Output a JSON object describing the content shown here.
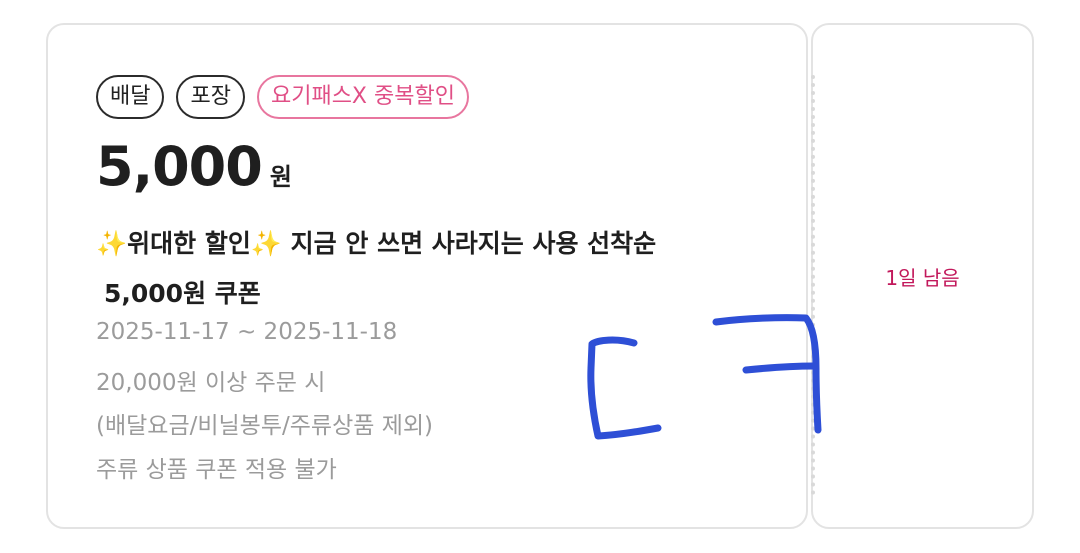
{
  "coupon": {
    "tags": [
      "배달",
      "포장",
      "요기패스X 중복할인"
    ],
    "price": {
      "value": "5,000",
      "unit": "원"
    },
    "title": {
      "line1": "✨위대한 할인✨ 지금 안 쓰면 사라지는 사용 선착순",
      "line2": "5,000원 쿠폰"
    },
    "period": "2025-11-17 ~ 2025-11-18",
    "min_order": "20,000원 이상 주문 시",
    "exclusions": "(배달요금/비닐봉투/주류상품 제외)",
    "restriction": "주류 상품 쿠폰 적용 불가",
    "remaining": "1일 남음"
  },
  "colors": {
    "pink_tag": "#e8769f",
    "remaining_text": "#c2185b",
    "scribble": "#2e4fd6"
  },
  "annotation": {
    "handwritten_text": "ㄷㅋ"
  }
}
